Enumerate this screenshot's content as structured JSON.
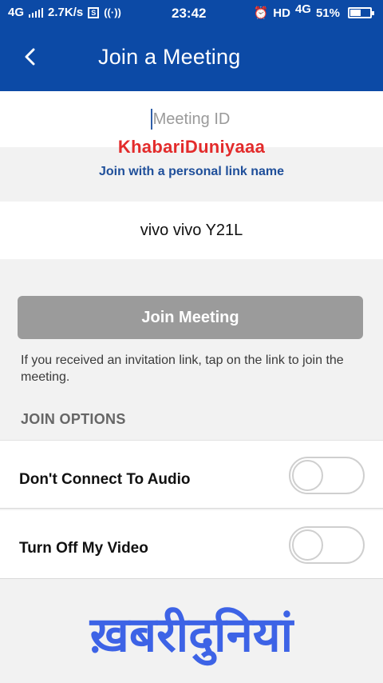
{
  "status_bar": {
    "network": "4G",
    "speed": "2.7K/s",
    "time": "23:42",
    "hd": "HD",
    "network_right": "4G",
    "battery_percent": "51%",
    "battery_level": 0.51
  },
  "header": {
    "back_icon": "chevron-left-icon",
    "title": "Join a Meeting",
    "color": "#0c4aa6"
  },
  "meeting_id": {
    "placeholder": "Meeting ID",
    "value": ""
  },
  "watermark_top": "KhabariDuniyaaa",
  "personal_link_label": "Join with a personal link name",
  "display_name": {
    "value": "vivo vivo Y21L"
  },
  "join_button": {
    "label": "Join Meeting",
    "enabled": false
  },
  "hint_text": "If you received an invitation link, tap on the link to join the meeting.",
  "options": {
    "header": "JOIN OPTIONS",
    "items": [
      {
        "label": "Don't Connect To Audio",
        "enabled": false
      },
      {
        "label": "Turn Off My Video",
        "enabled": false
      }
    ]
  },
  "watermark_bottom": "ख़बरीदुनियां"
}
